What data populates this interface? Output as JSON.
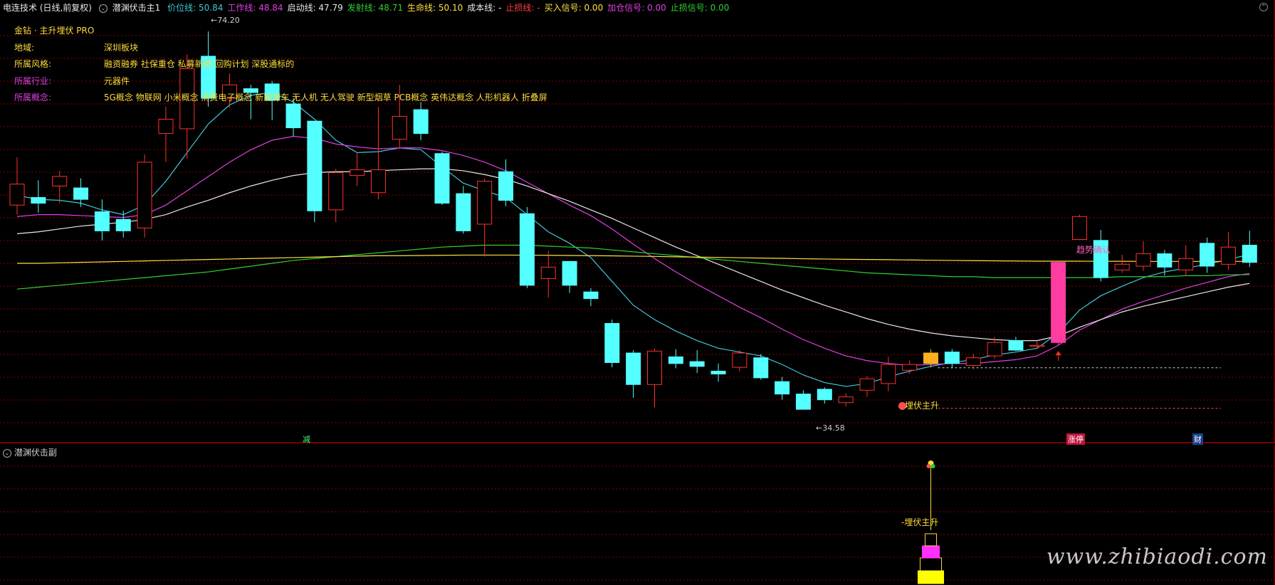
{
  "header": {
    "app_title": "电连技术 (日线,前复权)",
    "indicator_name": "潜渊伏击主1",
    "items": [
      {
        "label": "价位线:",
        "value": "50.84",
        "color": "#3fc8d8"
      },
      {
        "label": "工作线:",
        "value": "48.84",
        "color": "#e040e0"
      },
      {
        "label": "启动线:",
        "value": "47.79",
        "color": "#e8e8e8"
      },
      {
        "label": "发射线:",
        "value": "48.71",
        "color": "#30d030"
      },
      {
        "label": "生命线:",
        "value": "50.10",
        "color": "#ffe040"
      },
      {
        "label": "成本线:",
        "value": "-",
        "color": "#e8e8e8"
      },
      {
        "label": "止损线:",
        "value": "-",
        "color": "#ff4040"
      },
      {
        "label": "买入信号:",
        "value": "0.00",
        "color": "#ffe040"
      },
      {
        "label": "加仓信号:",
        "value": "0.00",
        "color": "#e040e0"
      },
      {
        "label": "止损信号:",
        "value": "0.00",
        "color": "#30d030"
      }
    ]
  },
  "info_panel": {
    "title": "金钻 · 主升埋伏 PRO",
    "rows": [
      {
        "key": "地域:",
        "value": "深圳板块",
        "key_color": "#ffdb3c"
      },
      {
        "key": "所属风格:",
        "value": "融资融券 社保重仓 私募新进 回购计划 深股通标的",
        "key_color": "#ffdb3c"
      },
      {
        "key": "所属行业:",
        "value": "元器件",
        "key_color": "#e040e0"
      },
      {
        "key": "所属概念:",
        "value": "5G概念 物联网 小米概念 消费电子概念 新能源车 无人机 无人驾驶 新型烟草 PCB概念 英伟达概念 人形机器人 折叠屏",
        "key_color": "#e040e0"
      }
    ]
  },
  "annotations": {
    "high_label": "74.20",
    "low_label": "34.58",
    "ambush_label": "埋伏主升",
    "trend_label": "趋势确认",
    "sub_ambush_label": "埋伏主升",
    "marker_left": "减",
    "marker_mid": "涨停",
    "marker_right": "财"
  },
  "sub_panel": {
    "title": "潜渊伏击副"
  },
  "watermark": "www.zhibiaodi.com",
  "colors": {
    "up": "#ff3030",
    "down": "#54ffff",
    "grid": "#8b0000",
    "ma_cyan": "#3fc8d8",
    "ma_magenta": "#e040e0",
    "ma_white": "#e8e8e8",
    "ma_green": "#30d030",
    "ma_yellow": "#ffe040",
    "signal_orange": "#ffb020",
    "signal_pink": "#ff3ca0"
  },
  "chart_data": {
    "type": "candlestick",
    "price_range": [
      32,
      76
    ],
    "high": 74.2,
    "low": 34.58,
    "candles": [
      {
        "o": 56.0,
        "c": 58.2,
        "h": 61.0,
        "l": 55.0
      },
      {
        "o": 56.8,
        "c": 56.2,
        "h": 58.6,
        "l": 55.2
      },
      {
        "o": 58.0,
        "c": 59.0,
        "h": 59.6,
        "l": 56.2
      },
      {
        "o": 57.8,
        "c": 56.6,
        "h": 58.8,
        "l": 55.8
      },
      {
        "o": 55.3,
        "c": 53.3,
        "h": 56.6,
        "l": 52.3
      },
      {
        "o": 54.5,
        "c": 53.3,
        "h": 55.4,
        "l": 52.6
      },
      {
        "o": 53.6,
        "c": 60.5,
        "h": 61.3,
        "l": 52.6
      },
      {
        "o": 63.5,
        "c": 65.0,
        "h": 66.3,
        "l": 60.5
      },
      {
        "o": 64.0,
        "c": 70.3,
        "h": 71.8,
        "l": 60.9
      },
      {
        "o": 71.6,
        "c": 67.2,
        "h": 74.2,
        "l": 66.3
      },
      {
        "o": 67.2,
        "c": 68.6,
        "h": 69.8,
        "l": 66.2
      },
      {
        "o": 68.2,
        "c": 67.8,
        "h": 68.6,
        "l": 65.0
      },
      {
        "o": 68.7,
        "c": 67.0,
        "h": 69.0,
        "l": 64.9
      },
      {
        "o": 66.6,
        "c": 64.1,
        "h": 67.2,
        "l": 63.2
      },
      {
        "o": 64.8,
        "c": 55.4,
        "h": 64.8,
        "l": 54.2
      },
      {
        "o": 55.5,
        "c": 59.4,
        "h": 59.8,
        "l": 54.2
      },
      {
        "o": 59.1,
        "c": 59.7,
        "h": 61.5,
        "l": 58.0
      },
      {
        "o": 57.3,
        "c": 59.7,
        "h": 66.3,
        "l": 56.6
      },
      {
        "o": 62.9,
        "c": 65.3,
        "h": 68.6,
        "l": 62.0
      },
      {
        "o": 66.0,
        "c": 63.5,
        "h": 66.8,
        "l": 62.8
      },
      {
        "o": 61.4,
        "c": 56.2,
        "h": 61.6,
        "l": 56.0
      },
      {
        "o": 57.2,
        "c": 53.3,
        "h": 58.0,
        "l": 53.0
      },
      {
        "o": 54.0,
        "c": 58.5,
        "h": 58.8,
        "l": 50.6
      },
      {
        "o": 59.5,
        "c": 56.5,
        "h": 60.8,
        "l": 55.9
      },
      {
        "o": 55.1,
        "c": 47.6,
        "h": 55.8,
        "l": 47.3
      },
      {
        "o": 48.3,
        "c": 49.5,
        "h": 51.2,
        "l": 46.3
      },
      {
        "o": 50.1,
        "c": 47.6,
        "h": 50.1,
        "l": 46.8
      },
      {
        "o": 46.9,
        "c": 46.2,
        "h": 47.3,
        "l": 45.4
      },
      {
        "o": 43.6,
        "c": 39.5,
        "h": 44.0,
        "l": 39.0
      },
      {
        "o": 40.5,
        "c": 37.2,
        "h": 40.8,
        "l": 35.8
      },
      {
        "o": 37.2,
        "c": 40.7,
        "h": 41.0,
        "l": 34.8
      },
      {
        "o": 40.1,
        "c": 39.4,
        "h": 40.9,
        "l": 38.9
      },
      {
        "o": 39.6,
        "c": 39.1,
        "h": 40.8,
        "l": 38.4
      },
      {
        "o": 38.6,
        "c": 38.3,
        "h": 39.4,
        "l": 37.5
      },
      {
        "o": 39.0,
        "c": 40.5,
        "h": 40.8,
        "l": 38.6
      },
      {
        "o": 40.0,
        "c": 37.9,
        "h": 40.4,
        "l": 37.7
      },
      {
        "o": 37.5,
        "c": 36.2,
        "h": 38.0,
        "l": 35.6
      },
      {
        "o": 36.2,
        "c": 34.6,
        "h": 36.6,
        "l": 34.58
      },
      {
        "o": 36.7,
        "c": 35.6,
        "h": 36.9,
        "l": 35.2
      },
      {
        "o": 35.3,
        "c": 35.9,
        "h": 36.3,
        "l": 34.9
      },
      {
        "o": 36.6,
        "c": 37.8,
        "h": 38.1,
        "l": 35.9
      },
      {
        "o": 37.3,
        "c": 39.3,
        "h": 40.1,
        "l": 36.5
      },
      {
        "o": 38.7,
        "c": 39.3,
        "h": 39.7,
        "l": 38.3
      },
      {
        "o": 39.4,
        "c": 40.5,
        "h": 40.9,
        "l": 39.0
      },
      {
        "o": 40.6,
        "c": 39.4,
        "h": 40.9,
        "l": 38.9
      },
      {
        "o": 39.2,
        "c": 40.0,
        "h": 40.4,
        "l": 38.8
      },
      {
        "o": 40.2,
        "c": 41.6,
        "h": 42.2,
        "l": 39.9
      },
      {
        "o": 41.8,
        "c": 40.8,
        "h": 42.2,
        "l": 40.7
      },
      {
        "o": 41.2,
        "c": 41.3,
        "h": 41.8,
        "l": 40.9
      },
      {
        "o": 41.6,
        "c": 50.0,
        "h": 50.1,
        "l": 41.3
      },
      {
        "o": 52.4,
        "c": 54.8,
        "h": 55.0,
        "l": 52.4
      },
      {
        "o": 52.3,
        "c": 48.4,
        "h": 53.4,
        "l": 48.0
      },
      {
        "o": 49.2,
        "c": 49.8,
        "h": 50.8,
        "l": 48.9
      },
      {
        "o": 49.6,
        "c": 50.9,
        "h": 52.2,
        "l": 49.1
      },
      {
        "o": 50.9,
        "c": 49.5,
        "h": 51.3,
        "l": 48.6
      },
      {
        "o": 49.2,
        "c": 50.4,
        "h": 51.8,
        "l": 48.6
      },
      {
        "o": 52.0,
        "c": 49.6,
        "h": 52.6,
        "l": 48.9
      },
      {
        "o": 49.8,
        "c": 51.6,
        "h": 53.2,
        "l": 49.2
      },
      {
        "o": 51.8,
        "c": 50.0,
        "h": 53.3,
        "l": 49.5
      }
    ],
    "special_candles": {
      "ambush_index": 43,
      "trend_index": 49
    },
    "series": [
      {
        "name": "价位线",
        "values": [
          57.0,
          56.6,
          56.5,
          56.2,
          55.5,
          55.0,
          56.0,
          58.5,
          61.5,
          64.5,
          66.5,
          67.5,
          67.8,
          66.8,
          65.0,
          62.8,
          61.5,
          61.6,
          62.0,
          61.8,
          60.0,
          58.3,
          57.5,
          56.8,
          55.0,
          53.2,
          52.0,
          50.5,
          48.0,
          45.5,
          44.0,
          42.8,
          41.8,
          41.0,
          40.6,
          40.2,
          39.3,
          38.2,
          37.4,
          37.0,
          37.3,
          38.0,
          38.6,
          39.1,
          39.5,
          39.8,
          40.3,
          40.6,
          41.0,
          42.6,
          45.0,
          46.5,
          47.5,
          48.4,
          49.0,
          49.4,
          49.8,
          50.3,
          50.84
        ]
      },
      {
        "name": "工作线",
        "values": [
          54.8,
          55.0,
          55.0,
          54.9,
          54.8,
          54.7,
          55.0,
          56.0,
          57.5,
          59.0,
          60.5,
          61.8,
          62.8,
          63.2,
          63.0,
          62.4,
          62.1,
          61.9,
          62.0,
          62.0,
          61.7,
          61.2,
          60.5,
          59.6,
          58.4,
          57.2,
          56.0,
          54.9,
          53.5,
          51.9,
          50.4,
          49.0,
          47.7,
          46.5,
          45.3,
          44.2,
          43.0,
          41.9,
          41.0,
          40.2,
          39.7,
          39.4,
          39.2,
          39.3,
          39.4,
          39.4,
          39.6,
          39.8,
          40.2,
          41.3,
          42.9,
          44.0,
          45.1,
          45.9,
          46.6,
          47.3,
          47.9,
          48.5,
          48.84
        ]
      },
      {
        "name": "启动线",
        "values": [
          53.0,
          53.2,
          53.5,
          53.8,
          54.0,
          54.2,
          54.5,
          55.0,
          55.8,
          56.5,
          57.3,
          58.0,
          58.6,
          59.1,
          59.4,
          59.5,
          59.5,
          59.6,
          59.7,
          59.8,
          59.8,
          59.6,
          59.2,
          58.7,
          58.0,
          57.2,
          56.4,
          55.5,
          54.6,
          53.6,
          52.6,
          51.6,
          50.7,
          49.8,
          48.9,
          48.0,
          47.1,
          46.3,
          45.5,
          44.8,
          44.1,
          43.5,
          43.0,
          42.6,
          42.3,
          42.1,
          41.9,
          41.8,
          41.8,
          42.3,
          43.2,
          44.0,
          44.8,
          45.4,
          45.9,
          46.4,
          46.9,
          47.4,
          47.79
        ]
      },
      {
        "name": "发射线",
        "values": [
          47.2,
          47.4,
          47.6,
          47.8,
          48.0,
          48.2,
          48.4,
          48.6,
          48.8,
          49.0,
          49.3,
          49.6,
          49.9,
          50.2,
          50.4,
          50.6,
          50.8,
          51.0,
          51.2,
          51.4,
          51.6,
          51.7,
          51.8,
          51.8,
          51.8,
          51.7,
          51.6,
          51.5,
          51.3,
          51.1,
          50.9,
          50.7,
          50.5,
          50.3,
          50.1,
          49.9,
          49.7,
          49.5,
          49.3,
          49.1,
          48.9,
          48.8,
          48.7,
          48.6,
          48.5,
          48.5,
          48.4,
          48.4,
          48.4,
          48.4,
          48.4,
          48.4,
          48.5,
          48.5,
          48.5,
          48.6,
          48.6,
          48.7,
          48.71
        ]
      },
      {
        "name": "生命线",
        "values": [
          49.9,
          49.9,
          49.95,
          50.0,
          50.05,
          50.1,
          50.15,
          50.2,
          50.25,
          50.3,
          50.35,
          50.4,
          50.45,
          50.5,
          50.55,
          50.6,
          50.65,
          50.7,
          50.7,
          50.72,
          50.74,
          50.76,
          50.76,
          50.76,
          50.75,
          50.74,
          50.72,
          50.7,
          50.68,
          50.65,
          50.62,
          50.58,
          50.55,
          50.52,
          50.48,
          50.45,
          50.42,
          50.38,
          50.35,
          50.32,
          50.3,
          50.28,
          50.25,
          50.22,
          50.2,
          50.18,
          50.16,
          50.14,
          50.12,
          50.12,
          50.12,
          50.11,
          50.11,
          50.1,
          50.1,
          50.1,
          50.1,
          50.1,
          50.1
        ]
      }
    ],
    "sub_bars": [
      {
        "index": 43,
        "top": 0.88,
        "bottom": 0.8,
        "color": "#ffff00"
      },
      {
        "index": 43,
        "top": 0.8,
        "bottom": 0.72,
        "color": "#ffcc00"
      },
      {
        "index": 43,
        "top": 0.72,
        "bottom": 0.64,
        "color": "#ff40ff"
      },
      {
        "index": 43,
        "top": 0.64,
        "bottom": 0.56,
        "color": "#000000"
      }
    ]
  }
}
